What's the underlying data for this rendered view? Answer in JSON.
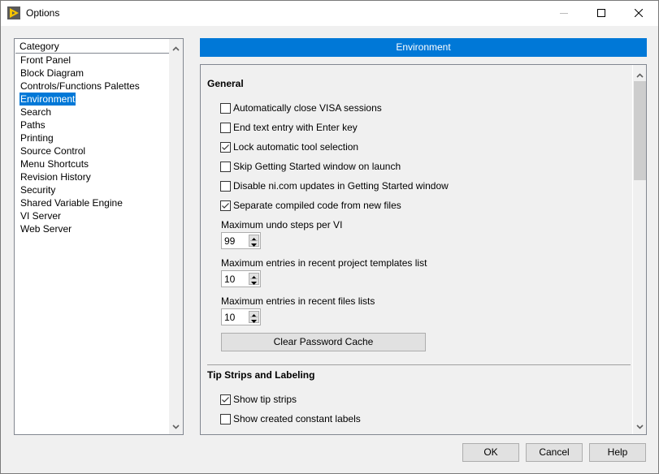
{
  "window": {
    "title": "Options",
    "icon": "labview-app-icon",
    "controls": {
      "minimize": "minimize-icon",
      "maximize": "maximize-icon",
      "close": "close-icon"
    }
  },
  "categories": {
    "header": "Category",
    "items": [
      {
        "label": "Front Panel",
        "selected": false
      },
      {
        "label": "Block Diagram",
        "selected": false
      },
      {
        "label": "Controls/Functions Palettes",
        "selected": false
      },
      {
        "label": "Environment",
        "selected": true
      },
      {
        "label": "Search",
        "selected": false
      },
      {
        "label": "Paths",
        "selected": false
      },
      {
        "label": "Printing",
        "selected": false
      },
      {
        "label": "Source Control",
        "selected": false
      },
      {
        "label": "Menu Shortcuts",
        "selected": false
      },
      {
        "label": "Revision History",
        "selected": false
      },
      {
        "label": "Security",
        "selected": false
      },
      {
        "label": "Shared Variable Engine",
        "selected": false
      },
      {
        "label": "VI Server",
        "selected": false
      },
      {
        "label": "Web Server",
        "selected": false
      }
    ]
  },
  "page": {
    "header": "Environment",
    "general": {
      "title": "General",
      "checkboxes": [
        {
          "label": "Automatically close VISA sessions",
          "checked": false
        },
        {
          "label": "End text entry with Enter key",
          "checked": false
        },
        {
          "label": "Lock automatic tool selection",
          "checked": true
        },
        {
          "label": "Skip Getting Started window on launch",
          "checked": false
        },
        {
          "label": "Disable ni.com updates in Getting Started window",
          "checked": false
        },
        {
          "label": "Separate compiled code from new files",
          "checked": true
        }
      ],
      "fields": [
        {
          "label": "Maximum undo steps per VI",
          "value": "99"
        },
        {
          "label": "Maximum entries in recent project templates list",
          "value": "10"
        },
        {
          "label": "Maximum entries in recent files lists",
          "value": "10"
        }
      ],
      "clear_password_cache": "Clear Password Cache"
    },
    "tip_strips": {
      "title": "Tip Strips and Labeling",
      "checkboxes": [
        {
          "label": "Show tip strips",
          "checked": true
        },
        {
          "label": "Show created constant labels",
          "checked": false
        }
      ]
    }
  },
  "footer": {
    "ok": "OK",
    "cancel": "Cancel",
    "help": "Help"
  },
  "colors": {
    "accent": "#0078d7",
    "app_icon_bg": "#5a5a5a",
    "app_icon_fg": "#f5c400"
  }
}
